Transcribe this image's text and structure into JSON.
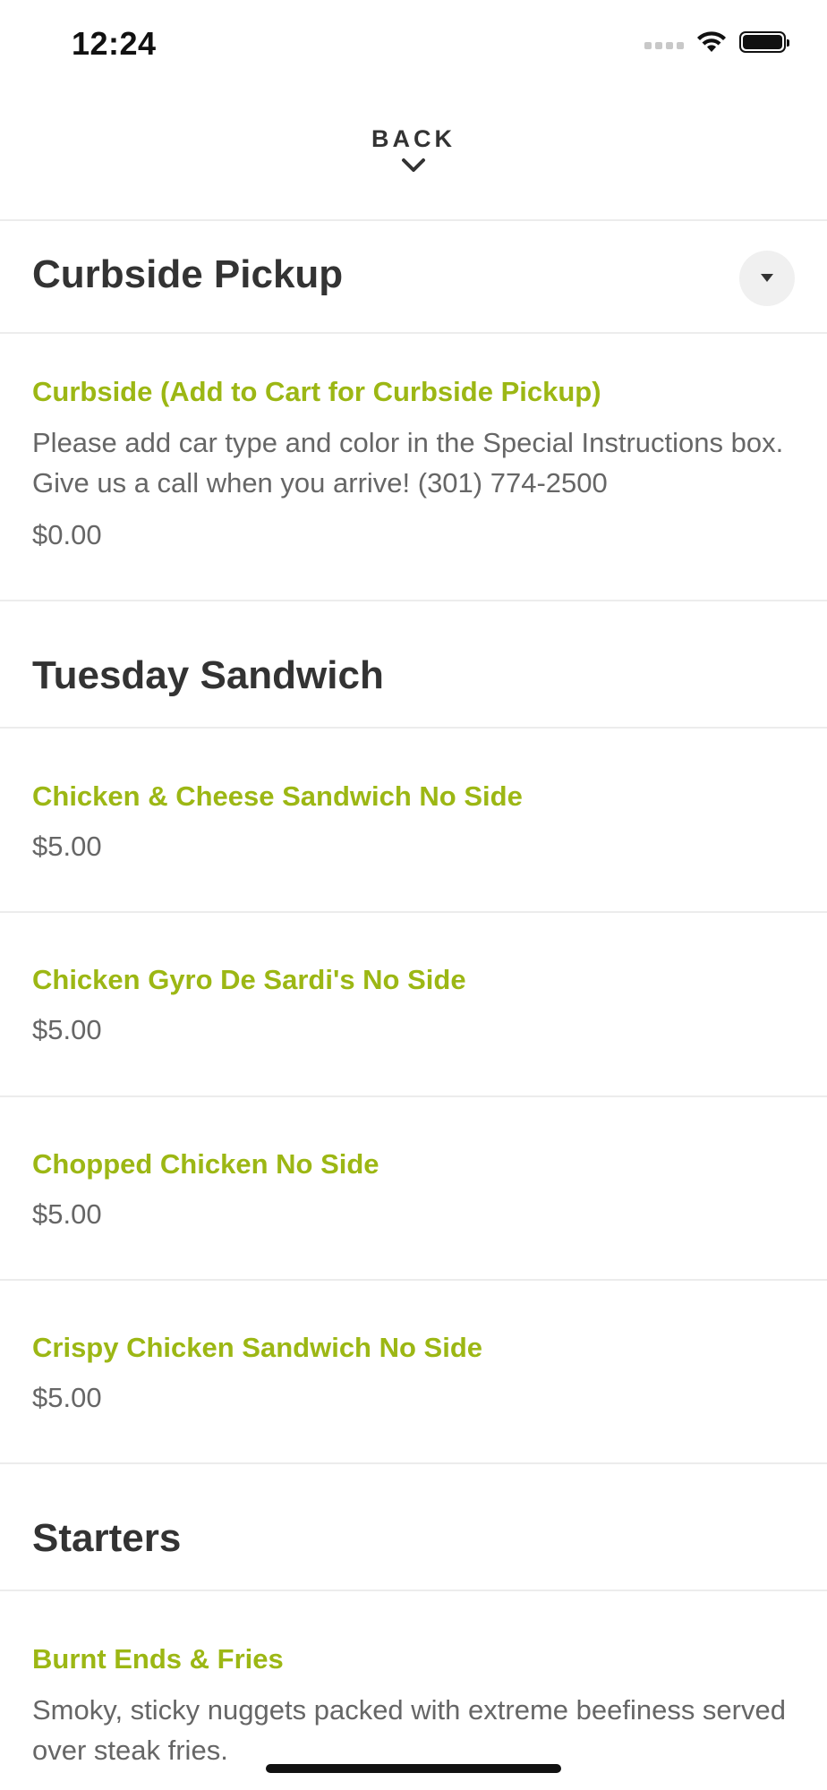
{
  "status_bar": {
    "time": "12:24"
  },
  "nav": {
    "back_label": "BACK"
  },
  "section_curbside": {
    "title": "Curbside Pickup",
    "items": [
      {
        "name": "Curbside (Add to Cart for Curbside Pickup)",
        "description": "Please add car type and color in the Special Instructions box. Give us a call when you arrive! (301) 774-2500",
        "price": "$0.00"
      }
    ]
  },
  "section_tuesday": {
    "title": "Tuesday Sandwich",
    "items": [
      {
        "name": "Chicken & Cheese Sandwich No Side",
        "price": "$5.00"
      },
      {
        "name": "Chicken Gyro De Sardi's No Side",
        "price": "$5.00"
      },
      {
        "name": "Chopped Chicken No Side",
        "price": "$5.00"
      },
      {
        "name": "Crispy Chicken Sandwich No Side",
        "price": "$5.00"
      }
    ]
  },
  "section_starters": {
    "title": "Starters",
    "items": [
      {
        "name": "Burnt Ends & Fries",
        "description": "Smoky, sticky nuggets packed with extreme beefiness served over steak fries."
      }
    ]
  },
  "colors": {
    "accent": "#9cb714",
    "text_primary": "#333333",
    "text_secondary": "#666666",
    "divider": "#ececec"
  },
  "icons": [
    "wifi-icon",
    "battery-icon",
    "cellular-signal-icon",
    "chevron-down-icon",
    "caret-down-icon"
  ]
}
